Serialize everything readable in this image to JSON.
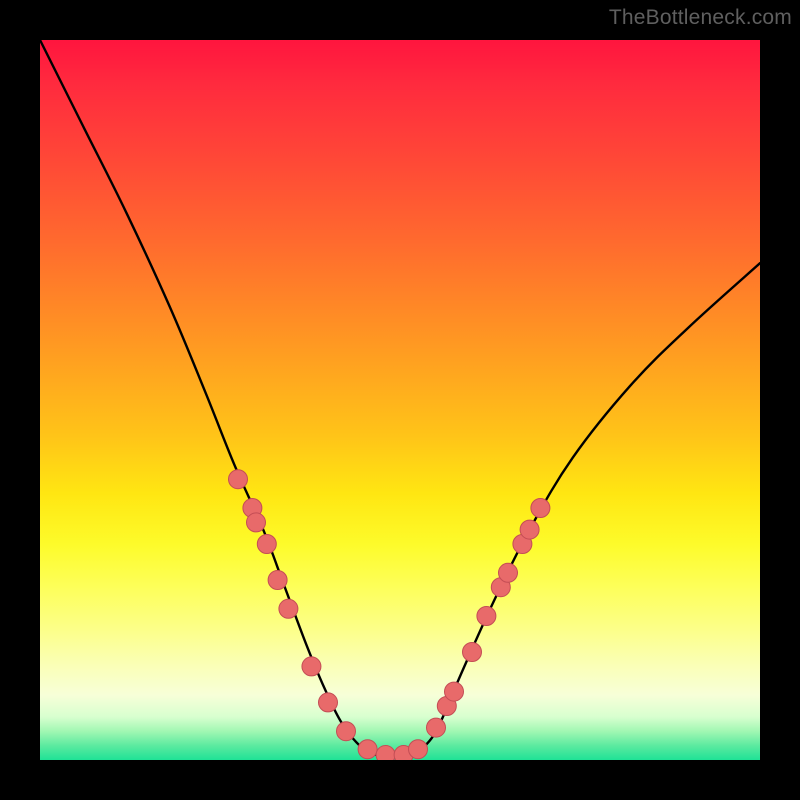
{
  "watermark": "TheBottleneck.com",
  "chart_data": {
    "type": "line",
    "title": "",
    "xlabel": "",
    "ylabel": "",
    "xlim": [
      0,
      100
    ],
    "ylim": [
      0,
      100
    ],
    "grid": false,
    "series": [
      {
        "name": "bottleneck-curve",
        "x": [
          0,
          6,
          12,
          18,
          23,
          27,
          31,
          34,
          37,
          39.5,
          42,
          45,
          48,
          51,
          53.5,
          55.5,
          58.5,
          63,
          68,
          74,
          82,
          90,
          100
        ],
        "values": [
          100,
          88,
          76,
          63,
          51,
          41,
          32,
          24,
          16,
          10,
          5,
          1.5,
          0.5,
          0.5,
          2,
          5,
          12,
          22,
          32,
          42,
          52,
          60,
          69
        ]
      }
    ],
    "markers": [
      {
        "name": "dot-left-1",
        "x": 27.5,
        "y": 39
      },
      {
        "name": "dot-left-2",
        "x": 29.5,
        "y": 35
      },
      {
        "name": "dot-left-3",
        "x": 30.0,
        "y": 33
      },
      {
        "name": "dot-left-4",
        "x": 31.5,
        "y": 30
      },
      {
        "name": "dot-left-5",
        "x": 33.0,
        "y": 25
      },
      {
        "name": "dot-left-6",
        "x": 34.5,
        "y": 21
      },
      {
        "name": "dot-left-7",
        "x": 37.7,
        "y": 13
      },
      {
        "name": "dot-left-8",
        "x": 40.0,
        "y": 8
      },
      {
        "name": "dot-left-9",
        "x": 42.5,
        "y": 4
      },
      {
        "name": "dot-bottom-1",
        "x": 45.5,
        "y": 1.5
      },
      {
        "name": "dot-bottom-2",
        "x": 48.0,
        "y": 0.7
      },
      {
        "name": "dot-bottom-3",
        "x": 50.5,
        "y": 0.7
      },
      {
        "name": "dot-bottom-4",
        "x": 52.5,
        "y": 1.5
      },
      {
        "name": "dot-right-1",
        "x": 55.0,
        "y": 4.5
      },
      {
        "name": "dot-right-2",
        "x": 56.5,
        "y": 7.5
      },
      {
        "name": "dot-right-3",
        "x": 57.5,
        "y": 9.5
      },
      {
        "name": "dot-right-4",
        "x": 60.0,
        "y": 15
      },
      {
        "name": "dot-right-5",
        "x": 62.0,
        "y": 20
      },
      {
        "name": "dot-right-6",
        "x": 64.0,
        "y": 24
      },
      {
        "name": "dot-right-7",
        "x": 65.0,
        "y": 26
      },
      {
        "name": "dot-right-8",
        "x": 67.0,
        "y": 30
      },
      {
        "name": "dot-right-9",
        "x": 68.0,
        "y": 32
      },
      {
        "name": "dot-right-10",
        "x": 69.5,
        "y": 35
      }
    ],
    "colors": {
      "curve": "#000000",
      "marker_fill": "#e86a6a",
      "marker_stroke": "#c44d55"
    }
  }
}
